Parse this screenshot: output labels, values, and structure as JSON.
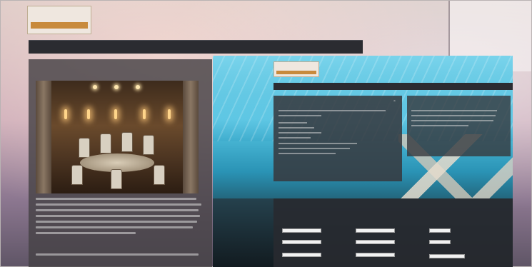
{
  "brand": {
    "logo_text": "",
    "accent_color": "#c88a3c",
    "nav_bg": "#2b2c31"
  },
  "main_nav": {
    "items": [
      "",
      "",
      "",
      "",
      "",
      "",
      ""
    ]
  },
  "left_panel": {
    "title": "",
    "photo_icon": "dining-room-photo",
    "subheading": ""
  },
  "overlay": {
    "logo_text": "",
    "nav_items": [
      "",
      "",
      "",
      "",
      "",
      "",
      ""
    ],
    "contact": {
      "title": "",
      "close_icon": "close-icon"
    },
    "reservations": {
      "title": ""
    },
    "form": {
      "title": ""
    }
  }
}
